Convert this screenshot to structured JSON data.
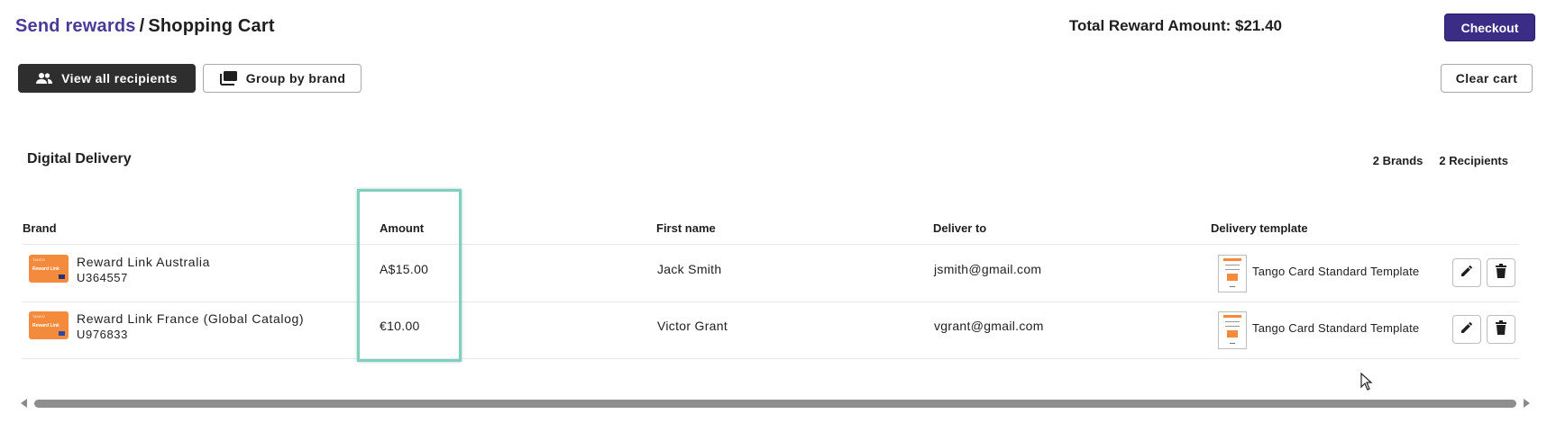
{
  "breadcrumb": {
    "parent": "Send rewards",
    "separator": "/",
    "current": "Shopping Cart"
  },
  "summary": {
    "total_label": "Total Reward Amount: $21.40"
  },
  "buttons": {
    "checkout": "Checkout",
    "view_all_recipients": "View all recipients",
    "group_by_brand": "Group by brand",
    "clear_cart": "Clear cart"
  },
  "section": {
    "title": "Digital Delivery",
    "brands_count": "2 Brands",
    "recipients_count": "2 Recipients"
  },
  "table": {
    "columns": [
      "Brand",
      "Amount",
      "First name",
      "Deliver to",
      "Delivery template"
    ],
    "rows": [
      {
        "brand": "Reward Link Australia",
        "id": "U364557",
        "amount": "A$15.00",
        "first_name": "Jack Smith",
        "deliver_to": "jsmith@gmail.com",
        "template": "Tango Card Standard Template"
      },
      {
        "brand": "Reward Link France (Global Catalog)",
        "id": "U976833",
        "amount": "€10.00",
        "first_name": "Victor Grant",
        "deliver_to": "vgrant@gmail.com",
        "template": "Tango Card Standard Template"
      }
    ]
  },
  "icons": {
    "recipients": "people-icon",
    "group": "stack-icon",
    "edit": "pencil-icon",
    "delete": "trash-icon"
  },
  "colors": {
    "link": "#4b3a97",
    "checkout_bg": "#3b2c86",
    "dark_button": "#2e2e2e",
    "brand_orange": "#f48a3c",
    "highlight": "#7fd0be"
  }
}
